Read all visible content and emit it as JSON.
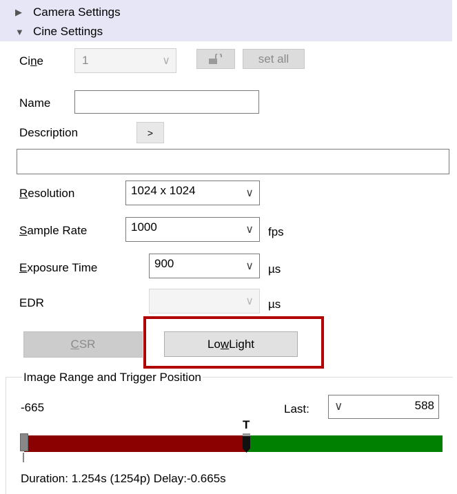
{
  "header": {
    "camera_settings": "Camera Settings",
    "cine_settings": "Cine Settings"
  },
  "cine": {
    "label_pre": "Ci",
    "label_u": "n",
    "label_post": "e",
    "value": "1",
    "set_all": "set all"
  },
  "name": {
    "label": "Name",
    "value": ""
  },
  "description": {
    "label": "Description",
    "expand": ">",
    "value": ""
  },
  "resolution": {
    "label_u": "R",
    "label_rest": "esolution",
    "value": "1024 x 1024"
  },
  "sample_rate": {
    "label_u": "S",
    "label_rest": "ample Rate",
    "value": "1000",
    "unit": "fps"
  },
  "exposure": {
    "label_u": "E",
    "label_rest": "xposure Time",
    "value": "900",
    "unit": "µs"
  },
  "edr": {
    "label": "EDR",
    "value": "",
    "unit": "µs"
  },
  "buttons": {
    "csr_u": "C",
    "csr_rest": "SR",
    "lowlight_pre": "Lo",
    "lowlight_u": "w",
    "lowlight_post": " Light"
  },
  "range": {
    "title": "Image Range and Trigger Position",
    "first": "-665",
    "last_label": "Last:",
    "last_value": "588",
    "trigger_marker": "T",
    "trigger_fraction": 0.53,
    "duration": "Duration: 1.254s (1254p) Delay:-0.665s"
  },
  "colors": {
    "pre_trigger": "#8b0000",
    "post_trigger": "#008000",
    "highlight": "#b00000",
    "header_bg": "#e6e6f6"
  }
}
